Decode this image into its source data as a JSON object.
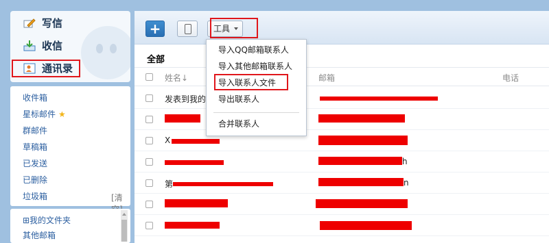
{
  "sidebar": {
    "compose_label": "写信",
    "inbox_action_label": "收信",
    "contacts_label": "通讯录",
    "folders": [
      "收件箱",
      "星标邮件",
      "群邮件",
      "草稿箱",
      "已发送",
      "已删除",
      "垃圾箱"
    ],
    "clear_label": "[清空]",
    "my_folders_label": "⊞我的文件夹",
    "other_mail_label": "其他邮箱"
  },
  "toolbar": {
    "add_label": "+",
    "tools_label": "工具"
  },
  "section_title": "全部",
  "table": {
    "columns": [
      "姓名↓",
      "邮箱",
      "电话"
    ],
    "rows": [
      {
        "name": "发表到我的",
        "name_tail": "",
        "email_tail": ""
      },
      {
        "name": "",
        "name_tail": "",
        "email_tail": ""
      },
      {
        "name": "X",
        "name_tail": "",
        "email_tail": ""
      },
      {
        "name": "",
        "name_tail": "",
        "email_tail": "h"
      },
      {
        "name": "第",
        "name_tail": "",
        "email_tail": "n"
      },
      {
        "name": "",
        "name_tail": "",
        "email_tail": ""
      },
      {
        "name": "",
        "name_tail": "",
        "email_tail": ""
      }
    ]
  },
  "tools_menu": {
    "items": [
      "导入QQ邮箱联系人",
      "导入其他邮箱联系人",
      "导入联系人文件",
      "导出联系人",
      "合并联系人"
    ]
  },
  "colors": {
    "highlight": "#e0161b",
    "redaction": "#ee0000",
    "link": "#2c5fa0",
    "accent": "#2a6fb3"
  }
}
